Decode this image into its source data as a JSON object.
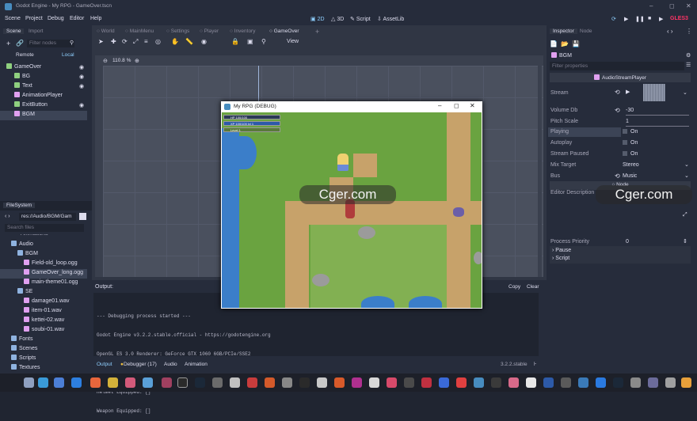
{
  "window": {
    "title": "Godot Engine - My RPG - GameOver.tscn"
  },
  "menu": [
    "Scene",
    "Project",
    "Debug",
    "Editor",
    "Help"
  ],
  "workspaces": [
    "2D",
    "3D",
    "Script",
    "AssetLib"
  ],
  "renderer": "GLES3",
  "scene_dock": {
    "tabs": [
      "Scene",
      "Import"
    ],
    "filter_placeholder": "Filter nodes",
    "remote": "Remote",
    "local": "Local",
    "nodes": [
      "GameOver",
      "BG",
      "Text",
      "AnimationPlayer",
      "ExitButton",
      "BGM"
    ]
  },
  "filesystem": {
    "tab": "FileSystem",
    "path": "res://Audio/BGM/Gam",
    "search_placeholder": "Search files",
    "items": [
      "Animations",
      "Audio",
      "BGM",
      "Field-old_loop.ogg",
      "GameOver_long.ogg",
      "main-theme01.ogg",
      "SE",
      "damage01.wav",
      "item-01.wav",
      "kettei-02.wav",
      "soubi-01.wav",
      "Fonts",
      "Scenes",
      "Scripts",
      "Textures"
    ]
  },
  "editor_tabs": [
    "World",
    "MainMenu",
    "Settings",
    "Player",
    "Inventory",
    "GameOver"
  ],
  "toolbar": {
    "view": "View",
    "zoom": "110.8 %"
  },
  "output": {
    "title": "Output:",
    "copy": "Copy",
    "clear": "Clear",
    "lines": [
      "--- Debugging process started ---",
      "Godot Engine v3.2.2.stable.official - https://godotengine.org",
      "OpenGL ES 3.0 Renderer: GeForce GTX 1060 6GB/PCIe/SSE2",
      "",
      "Helmet Equipped: []",
      "Weapon Equipped: []"
    ],
    "bottom_tabs": [
      "Output",
      "Debugger (17)",
      "Audio",
      "Animation"
    ],
    "version": "3.2.2.stable"
  },
  "game_window": {
    "title": "My RPG (DEBUG)",
    "hud": [
      "HP 100/100",
      "XP 100/100 lvl 1",
      "Level 1"
    ]
  },
  "inspector": {
    "tabs": [
      "Inspector",
      "Node"
    ],
    "node_name": "BGM",
    "filter_placeholder": "Filter properties",
    "class": "AudioStreamPlayer",
    "props": [
      {
        "label": "Stream",
        "value": ""
      },
      {
        "label": "Volume Db",
        "value": "-30"
      },
      {
        "label": "Pitch Scale",
        "value": "1"
      },
      {
        "label": "Playing",
        "value": "On"
      },
      {
        "label": "Autoplay",
        "value": "On"
      },
      {
        "label": "Stream Paused",
        "value": "On"
      },
      {
        "label": "Mix Target",
        "value": "Stereo"
      },
      {
        "label": "Bus",
        "value": "Music"
      }
    ],
    "node_section": "Node",
    "editor_description": "Editor Description",
    "process_priority_label": "Process Priority",
    "process_priority_value": "0",
    "pause": "Pause",
    "script": "Script"
  },
  "watermark": "Cger.com",
  "colors": {
    "accent": "#478cbf",
    "bg": "#202531",
    "panel": "#262c3b"
  }
}
